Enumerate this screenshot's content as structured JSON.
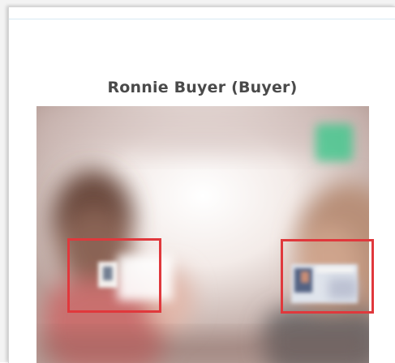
{
  "participant": {
    "name_label": "Ronnie Buyer (Buyer)"
  },
  "video_feed": {
    "indicator_color": "#36c98a",
    "highlight_color": "#e0383c",
    "highlights": [
      {
        "name": "left-id-card"
      },
      {
        "name": "right-id-card"
      }
    ]
  }
}
